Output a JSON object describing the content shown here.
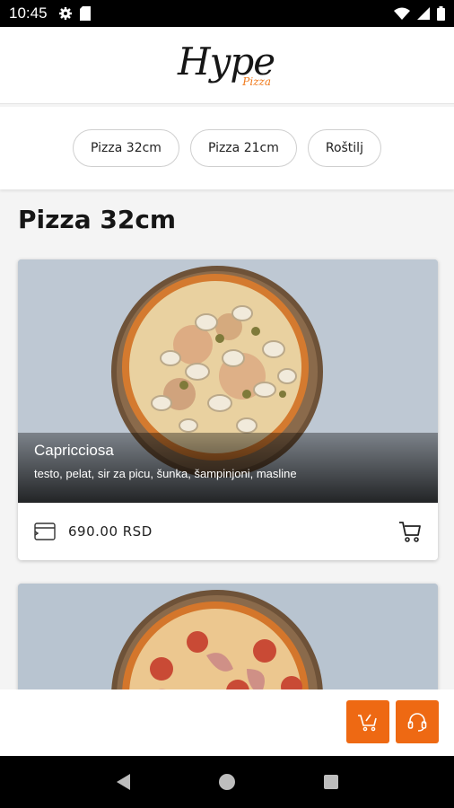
{
  "status_bar": {
    "time": "10:45",
    "icons": [
      "settings-icon",
      "sim-card-icon",
      "wifi-icon",
      "signal-icon",
      "battery-icon"
    ]
  },
  "header": {
    "logo_main": "Hype",
    "logo_sub": "Pizza",
    "accent_color": "#f07a1c"
  },
  "categories": [
    {
      "label": "Pizza 32cm"
    },
    {
      "label": "Pizza 21cm"
    },
    {
      "label": "Roštilj"
    }
  ],
  "section": {
    "title": "Pizza 32cm"
  },
  "products": [
    {
      "name": "Capricciosa",
      "description": "testo, pelat, sir za picu, šunka, šampinjoni, masline",
      "price": "690.00 RSD",
      "image": "pizza-capricciosa-image"
    },
    {
      "name": "",
      "description": "",
      "price": "",
      "image": "pizza-image"
    }
  ],
  "actions": {
    "cart_icon": "cart-icon",
    "support_icon": "headset-icon",
    "button_color": "#ee6913"
  },
  "nav_bar": {
    "icons": [
      "back-icon",
      "home-icon",
      "recents-icon"
    ]
  }
}
